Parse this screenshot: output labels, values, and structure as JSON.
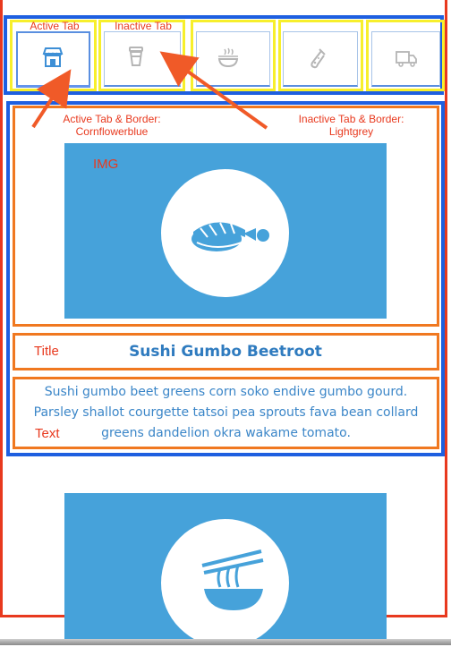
{
  "annotations": {
    "active_tab": "Active Tab",
    "inactive_tab": "Inactive Tab",
    "active_tab_border_line1": "Active Tab & Border:",
    "active_tab_border_line2": "Cornflowerblue",
    "inactive_tab_border_line1": "Inactive Tab & Border:",
    "inactive_tab_border_line2": "Lightgrey",
    "img": "IMG",
    "title": "Title",
    "text": "Text"
  },
  "tabs": [
    {
      "icon": "store-icon",
      "state": "active"
    },
    {
      "icon": "coffee-cup-icon",
      "state": "inactive"
    },
    {
      "icon": "food-bowl-icon",
      "state": "inactive"
    },
    {
      "icon": "flask-icon",
      "state": "inactive"
    },
    {
      "icon": "truck-icon",
      "state": "inactive"
    }
  ],
  "card": {
    "image_icon": "sushi-icon",
    "title": "Sushi Gumbo Beetroot",
    "text": "Sushi gumbo beet greens corn soko endive gumbo gourd. Parsley shallot courgette tatsoi pea sprouts fava bean collard greens dandelion okra wakame tomato."
  },
  "next_card": {
    "image_icon": "noodles-icon"
  },
  "colors": {
    "active_tab_border": "#6495ed",
    "inactive_tab_border": "#d3d3d3",
    "image_background": "#46a2da",
    "title": "#2f7bbf",
    "annotation": "#e8391e",
    "frame_blue": "#1e5fe0",
    "frame_orange": "#f07820",
    "frame_yellow": "#f7ef2c"
  }
}
